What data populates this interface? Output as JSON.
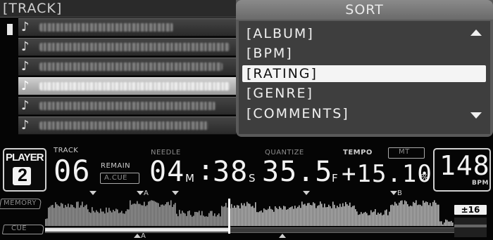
{
  "browser": {
    "header_title": "[TRACK]",
    "rows": 6,
    "selected_row": 4
  },
  "sort_menu": {
    "title": "SORT",
    "options": [
      "[ALBUM]",
      "[BPM]",
      "[RATING]",
      "[GENRE]",
      "[COMMENTS]"
    ],
    "selected_index": 2
  },
  "player": {
    "label": "PLAYER",
    "number": "2"
  },
  "track": {
    "label": "TRACK",
    "number": "06"
  },
  "remain": {
    "label": "REMAIN",
    "acue_label": "A.CUE"
  },
  "needle": {
    "label": "NEEDLE"
  },
  "time": {
    "minutes": "04",
    "minutes_unit": "M",
    "colon": ":",
    "seconds": "38",
    "seconds_unit": "S",
    "frames": "35.5",
    "frames_unit": "F"
  },
  "quantize": {
    "label": "QUANTIZE"
  },
  "tempo": {
    "label": "TEMPO",
    "mt_label": "MT",
    "value": "+15.10",
    "unit": "%"
  },
  "bpm": {
    "value": "148",
    "unit": "BPM"
  },
  "waveform": {
    "memory_label": "MEMORY",
    "cue_label": "CUE",
    "marker_a": "A",
    "marker_b": "B",
    "playhead_fraction": 0.45,
    "pitch_range": "±16"
  },
  "colors": {
    "background": "#050505",
    "text": "#f2f2f2",
    "menu_background": "#3e3e3e",
    "menu_selection": "#f4f4f4"
  }
}
